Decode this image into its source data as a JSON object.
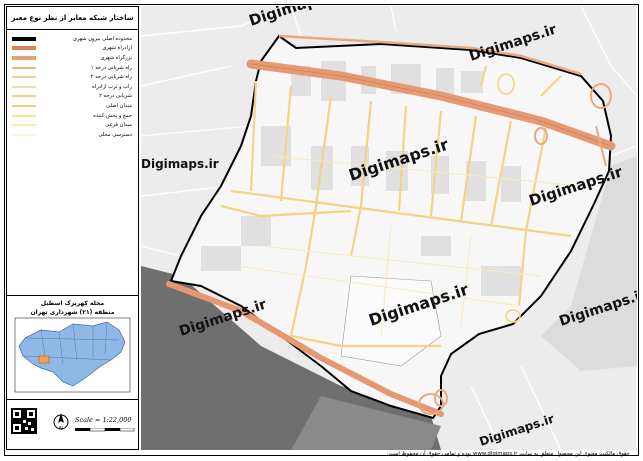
{
  "legend": {
    "title": "ساختار شبکه معابر از نظر نوع معبر",
    "items": [
      {
        "label": "محدوده اصلی بیرون شهری",
        "color": "#000000",
        "style": "line-thick"
      },
      {
        "label": "آزادراه شهری",
        "color": "#d9855a",
        "style": "line-thick"
      },
      {
        "label": "بزرگراه شهری",
        "color": "#e8a07c",
        "style": "line-thick"
      },
      {
        "label": "راه شریانی درجه ۱",
        "color": "#f0b48f",
        "style": "line"
      },
      {
        "label": "راه شریانی درجه ۲",
        "color": "#f6c9a8",
        "style": "line"
      },
      {
        "label": "راب و ترب آزادراه",
        "color": "#f8d5b8",
        "style": "line"
      },
      {
        "label": "شریانی درجه ۲",
        "color": "#f6d27a",
        "style": "line"
      },
      {
        "label": "میدان اصلی",
        "color": "#f4cc6a",
        "style": "line"
      },
      {
        "label": "جمع و پخش کننده",
        "color": "#f8df9c",
        "style": "line"
      },
      {
        "label": "میدان فرعی",
        "color": "#fbe8b8",
        "style": "line"
      },
      {
        "label": "دسترسی محلی",
        "color": "#fdf2d6",
        "style": "line"
      }
    ]
  },
  "inset": {
    "title_line1": "محله کهریزک اسطبل",
    "title_line2": "منطقه (۲۱) شهرداری تهران"
  },
  "scale": {
    "text": "Scale = 1:22,000"
  },
  "map": {
    "watermark": "Digimaps.ir"
  },
  "credit": "حقوق مالکیت معنوی این محصول متعلق به سایت www.digimaps.ir بوده و تمامی حقوق آن محفوظ است."
}
